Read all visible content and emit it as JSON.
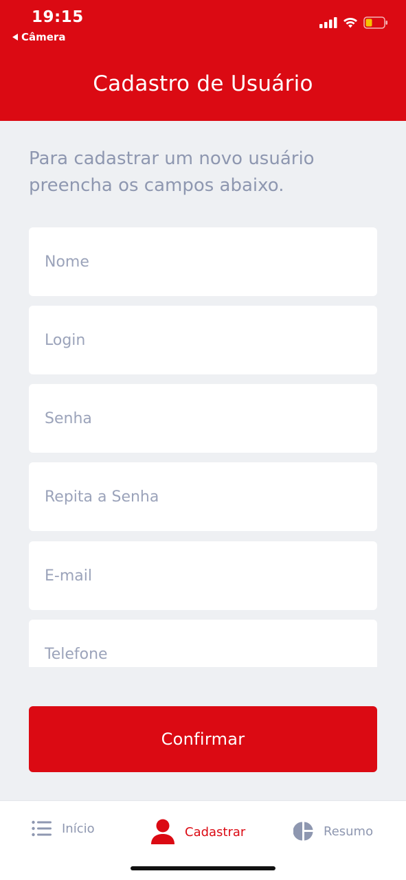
{
  "status_bar": {
    "time": "19:15",
    "back_app": "Câmera"
  },
  "header": {
    "title": "Cadastro de Usuário"
  },
  "intro_text": "Para cadastrar um novo usuário preencha os campos abaixo.",
  "form": {
    "fields": [
      {
        "placeholder": "Nome",
        "value": ""
      },
      {
        "placeholder": "Login",
        "value": ""
      },
      {
        "placeholder": "Senha",
        "value": ""
      },
      {
        "placeholder": "Repita a Senha",
        "value": ""
      },
      {
        "placeholder": "E-mail",
        "value": ""
      },
      {
        "placeholder": "Telefone",
        "value": ""
      }
    ],
    "confirm_label": "Confirmar"
  },
  "tabs": [
    {
      "label": "Início",
      "icon": "list-icon",
      "active": false
    },
    {
      "label": "Cadastrar",
      "icon": "user-icon",
      "active": true
    },
    {
      "label": "Resumo",
      "icon": "pie-chart-icon",
      "active": false
    }
  ],
  "colors": {
    "brand_red": "#db0a13",
    "background": "#eef0f3",
    "muted_text": "#8e97b0",
    "battery_fill": "#f5c400"
  }
}
